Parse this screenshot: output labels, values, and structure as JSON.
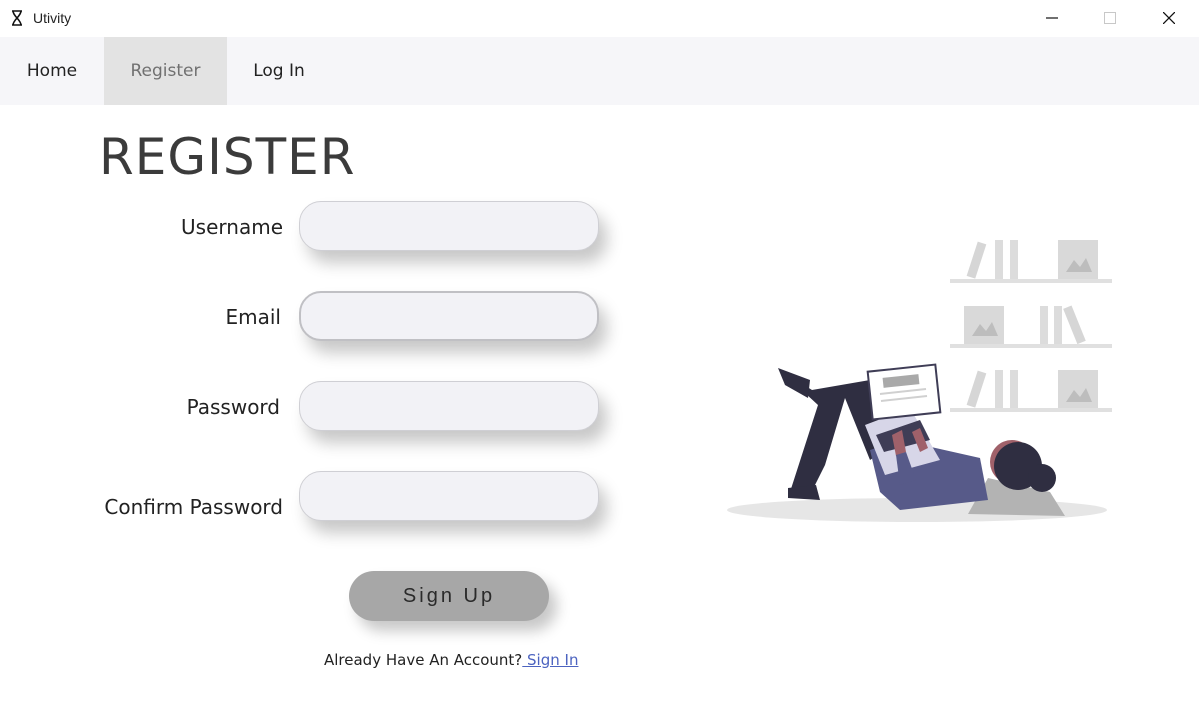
{
  "window": {
    "title": "Utivity",
    "controls": [
      "minimize-icon",
      "maximize-icon",
      "close-icon"
    ]
  },
  "nav": {
    "items": [
      {
        "label": "Home",
        "active": false
      },
      {
        "label": "Register",
        "active": true
      },
      {
        "label": "Log In",
        "active": false
      }
    ]
  },
  "page": {
    "heading": "REGISTER"
  },
  "form": {
    "fields": [
      {
        "label": "Username",
        "value": "",
        "placeholder": ""
      },
      {
        "label": "Email",
        "value": "",
        "placeholder": ""
      },
      {
        "label": "Password",
        "value": "",
        "placeholder": ""
      },
      {
        "label": "Confirm Password",
        "value": "",
        "placeholder": ""
      }
    ],
    "submit_label": "Sign Up",
    "account_prompt": "Already Have An Account?",
    "signin_label": " Sign In"
  },
  "colors": {
    "nav_bg": "#f6f6f9",
    "nav_active_bg": "#e3e3e3",
    "button_bg": "#a7a7a7",
    "link": "#4c63c0",
    "input_bg": "#f2f2f6",
    "illustration_accent": "#5a5a9a"
  }
}
